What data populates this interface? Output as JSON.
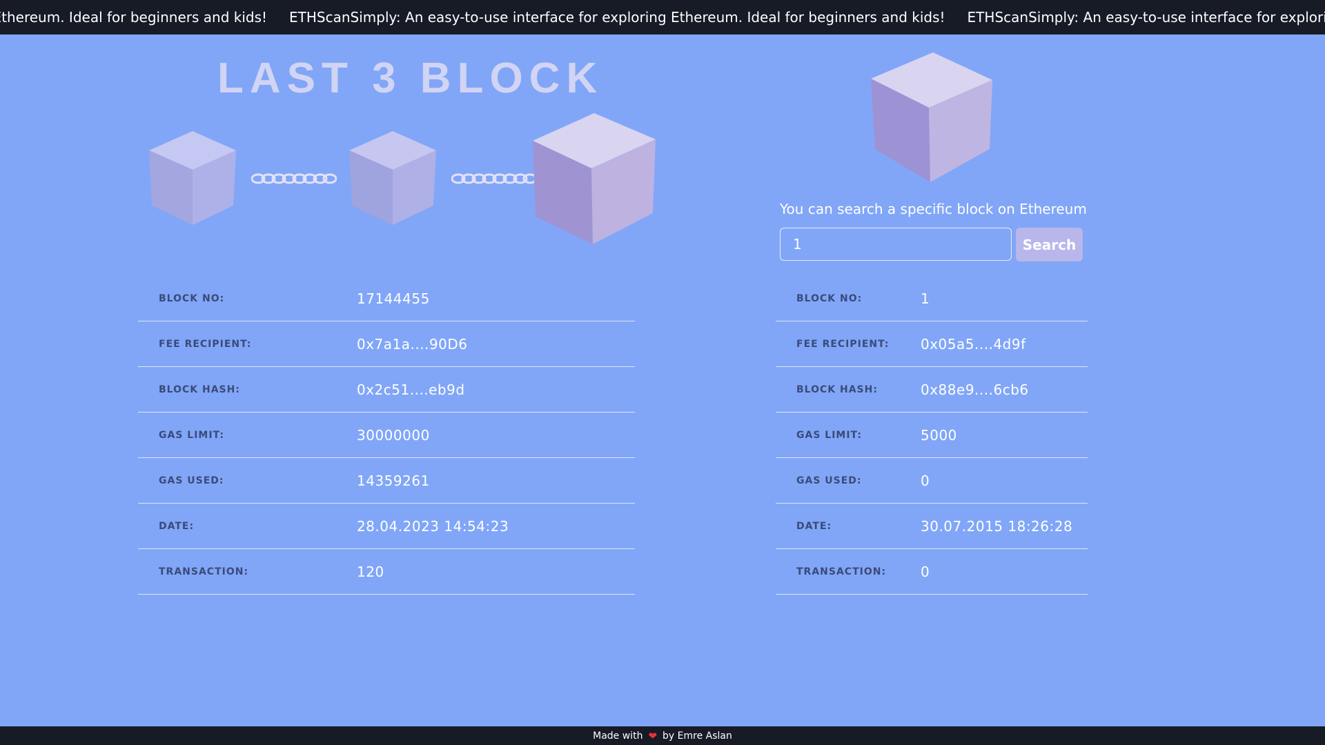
{
  "ticker": {
    "text": "ETHScanSimply: An easy-to-use interface for exploring Ethereum. Ideal for beginners and kids!"
  },
  "title": "LAST 3 BLOCK",
  "icons": {
    "cube": "cube-icon",
    "chain": "chain-link-icon",
    "heart": "heart-icon"
  },
  "colors": {
    "background": "#81a6f7",
    "bar": "#161b26",
    "cube_top": "#d8d6f2",
    "cube_left": "#9c94d3",
    "cube_right": "#bbb3e1",
    "button": "#b9b6eb",
    "heart": "#e8313a"
  },
  "latest_block": {
    "rows": [
      {
        "label": "BLOCK NO:",
        "value": "17144455"
      },
      {
        "label": "FEE RECIPIENT:",
        "value": "0x7a1a....90D6"
      },
      {
        "label": "BLOCK HASH:",
        "value": "0x2c51....eb9d"
      },
      {
        "label": "GAS LIMIT:",
        "value": "30000000"
      },
      {
        "label": "GAS USED:",
        "value": "14359261"
      },
      {
        "label": "DATE:",
        "value": "28.04.2023 14:54:23"
      },
      {
        "label": "TRANSACTION:",
        "value": "120"
      }
    ]
  },
  "search": {
    "caption": "You can search a specific block on Ethereum",
    "input_value": "1",
    "button_label": "Search"
  },
  "searched_block": {
    "rows": [
      {
        "label": "BLOCK NO:",
        "value": "1"
      },
      {
        "label": "FEE RECIPIENT:",
        "value": "0x05a5....4d9f"
      },
      {
        "label": "BLOCK HASH:",
        "value": "0x88e9....6cb6"
      },
      {
        "label": "GAS LIMIT:",
        "value": "5000"
      },
      {
        "label": "GAS USED:",
        "value": "0"
      },
      {
        "label": "DATE:",
        "value": "30.07.2015 18:26:28"
      },
      {
        "label": "TRANSACTION:",
        "value": "0"
      }
    ]
  },
  "footer": {
    "made_with": "Made with",
    "heart": "❤",
    "by": "by Emre Aslan"
  }
}
